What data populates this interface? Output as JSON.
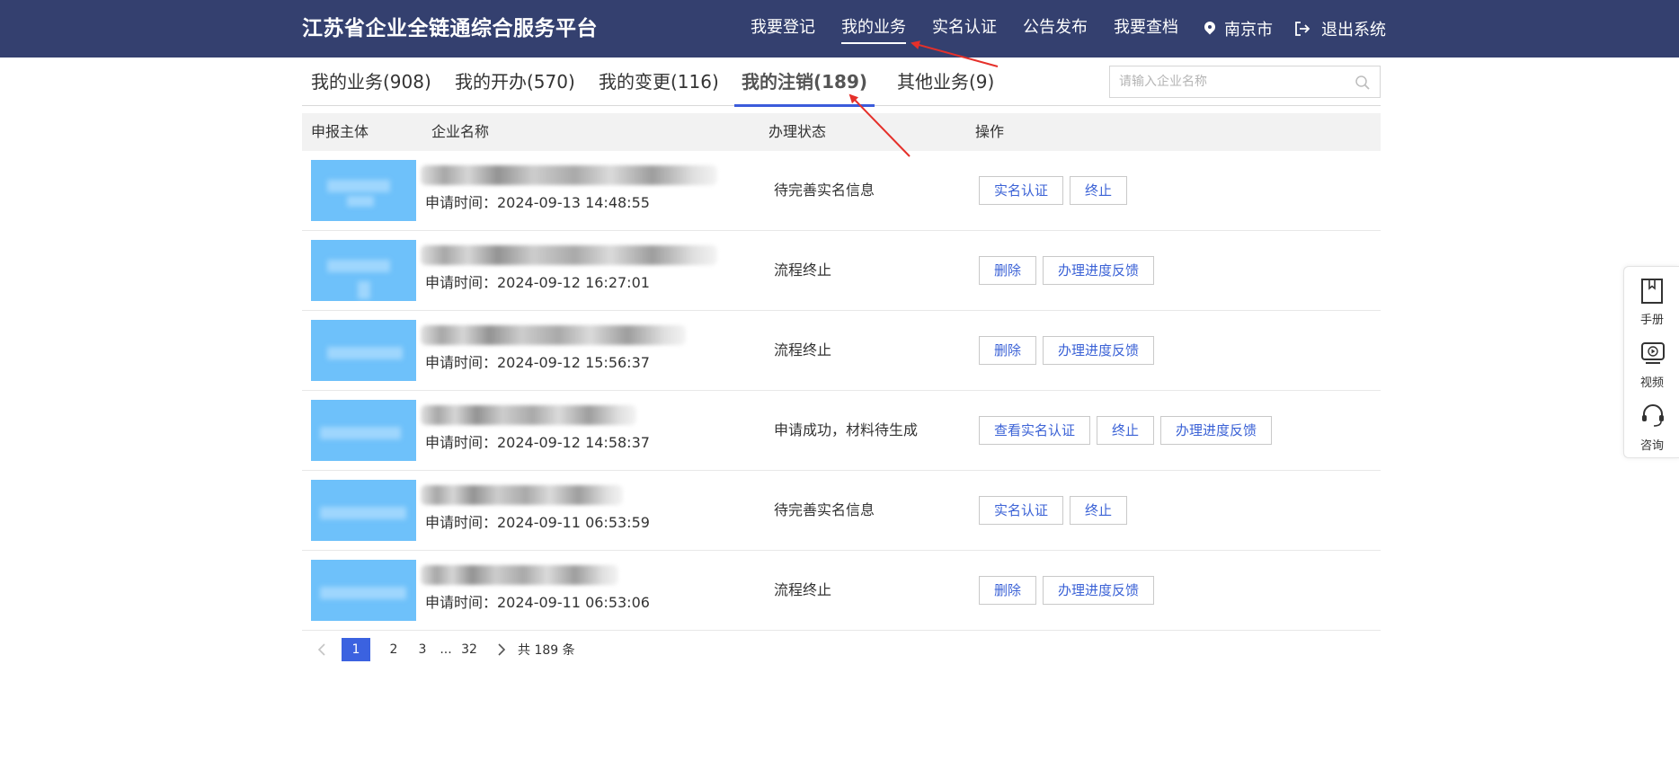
{
  "header": {
    "title": "江苏省企业全链通综合服务平台",
    "nav": [
      "我要登记",
      "我的业务",
      "实名认证",
      "公告发布",
      "我要查档"
    ],
    "active_nav": "我的业务",
    "location": "南京市",
    "logout": "退出系统"
  },
  "tabs": [
    {
      "label": "我的业务(908)"
    },
    {
      "label": "我的开办(570)"
    },
    {
      "label": "我的变更(116)"
    },
    {
      "label": "我的注销(189)"
    },
    {
      "label": "其他业务(9)"
    }
  ],
  "active_tab": "我的注销(189)",
  "search": {
    "placeholder": "请输入企业名称"
  },
  "table": {
    "headers": [
      "申报主体",
      "企业名称",
      "办理状态",
      "操作"
    ],
    "rows": [
      {
        "time": "申请时间：2024-09-13 14:48:55",
        "status": "待完善实名信息",
        "ops": [
          "实名认证",
          "终止"
        ]
      },
      {
        "time": "申请时间：2024-09-12 16:27:01",
        "status": "流程终止",
        "ops": [
          "删除",
          "办理进度反馈"
        ]
      },
      {
        "time": "申请时间：2024-09-12 15:56:37",
        "status": "流程终止",
        "ops": [
          "删除",
          "办理进度反馈"
        ]
      },
      {
        "time": "申请时间：2024-09-12 14:58:37",
        "status": "申请成功，材料待生成",
        "ops": [
          "查看实名认证",
          "终止",
          "办理进度反馈"
        ]
      },
      {
        "time": "申请时间：2024-09-11 06:53:59",
        "status": "待完善实名信息",
        "ops": [
          "实名认证",
          "终止"
        ]
      },
      {
        "time": "申请时间：2024-09-11 06:53:06",
        "status": "流程终止",
        "ops": [
          "删除",
          "办理进度反馈"
        ]
      }
    ]
  },
  "pagination": {
    "pages": [
      "1",
      "2",
      "3"
    ],
    "ellipsis": "...",
    "last": "32",
    "current": 1,
    "total": "共 189 条"
  },
  "side_panel": {
    "items": [
      "手册",
      "视频",
      "咨询"
    ]
  },
  "colors": {
    "header_bg": "#34406f",
    "accent": "#3b62d6",
    "thumb": "#6ec1fa",
    "annotation": "#e5302a"
  }
}
